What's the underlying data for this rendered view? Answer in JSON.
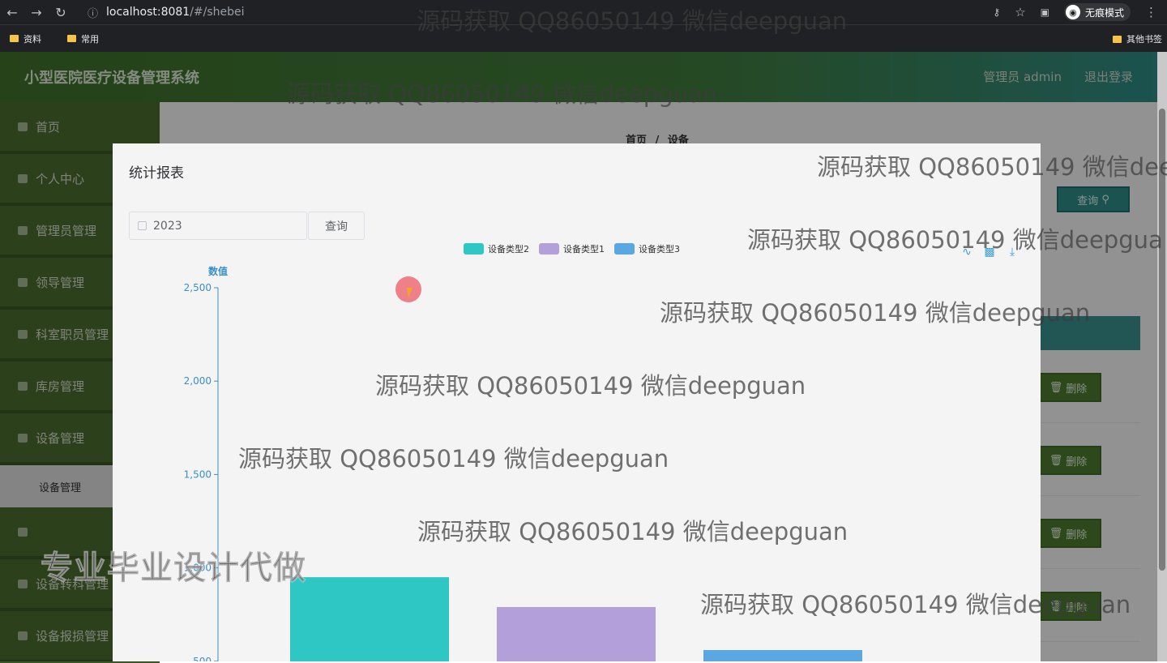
{
  "browser": {
    "url_host": "localhost:8081",
    "url_path": "/#/shebei",
    "incognito_label": "无痕模式",
    "bookmarks": [
      "资料",
      "常用"
    ],
    "other_bookmarks": "其他书签"
  },
  "app": {
    "title": "小型医院医疗设备管理系统",
    "user": "管理员 admin",
    "logout": "退出登录"
  },
  "sidebar": {
    "items": [
      {
        "label": "首页"
      },
      {
        "label": "个人中心"
      },
      {
        "label": "管理员管理"
      },
      {
        "label": "领导管理"
      },
      {
        "label": "科室职员管理"
      },
      {
        "label": "库房管理"
      },
      {
        "label": "设备管理"
      }
    ],
    "sub_item": "设备管理",
    "items_after": [
      {
        "label": ""
      },
      {
        "label": "设备转科管理"
      },
      {
        "label": "设备报损管理"
      }
    ]
  },
  "content": {
    "breadcrumb_home": "首页",
    "breadcrumb_sep": "/",
    "breadcrumb_current": "设备",
    "search_button": "查询",
    "delete_button": "删除"
  },
  "dialog": {
    "title": "统计报表",
    "year_value": "2023",
    "query_button": "查询"
  },
  "chart_data": {
    "type": "bar",
    "ylabel": "数值",
    "ylim": [
      0,
      2500
    ],
    "yticks": [
      "2,500",
      "2,000",
      "1,500",
      "1,000",
      "500"
    ],
    "ytick_values": [
      2500,
      2000,
      1500,
      1000,
      500
    ],
    "series": [
      {
        "name": "设备类型2",
        "values": [
          950
        ],
        "color": "#2ec7c4"
      },
      {
        "name": "设备类型1",
        "values": [
          790
        ],
        "color": "#b3a0da"
      },
      {
        "name": "设备类型3",
        "values": [
          560
        ],
        "color": "#5aa7e2"
      }
    ],
    "legend_position": "top-center"
  },
  "watermarks": {
    "text": "源码获取 QQ86050149 微信deepguan",
    "text_clipped_1": "源码获取 QQ86050149 微信dee",
    "text_clipped_2": "源码获取 QQ86050149 微信deepgua",
    "banner": "专业毕业设计代做"
  }
}
